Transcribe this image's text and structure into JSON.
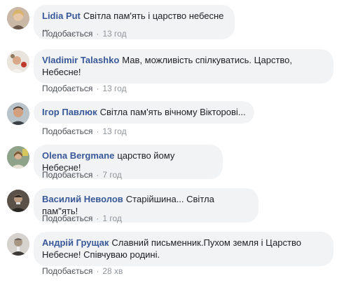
{
  "comments": [
    {
      "author": "Lidia Put",
      "text": "Світла пам'ять і царство небесне ...",
      "like_label": "Подобається",
      "separator": "·",
      "time": "13 год"
    },
    {
      "author": "Vladimir Talashko",
      "text": "Мав, можливість спілкуватись. Царство, Небесне!",
      "like_label": "Подобається",
      "separator": "·",
      "time": "13 год"
    },
    {
      "author": "Ігор Павлюк",
      "text": "Світла пам'ять вічному Вікторові...",
      "like_label": "Подобається",
      "separator": "·",
      "time": "13 год"
    },
    {
      "author": "Olena Bergmane",
      "text": "царство йому Небесне!",
      "like_label": "Подобається",
      "separator": "·",
      "time": "7 год"
    },
    {
      "author": "Василий Неволов",
      "text": "Старійшина... Світла пам\"ять!",
      "like_label": "Подобається",
      "separator": "·",
      "time": "1 год"
    },
    {
      "author": "Андрій Грущак",
      "text": "Славний письменник.Пухом земля і Царство Небесне! Співчуваю родині.",
      "like_label": "Подобається",
      "separator": "·",
      "time": "28 хв"
    }
  ]
}
